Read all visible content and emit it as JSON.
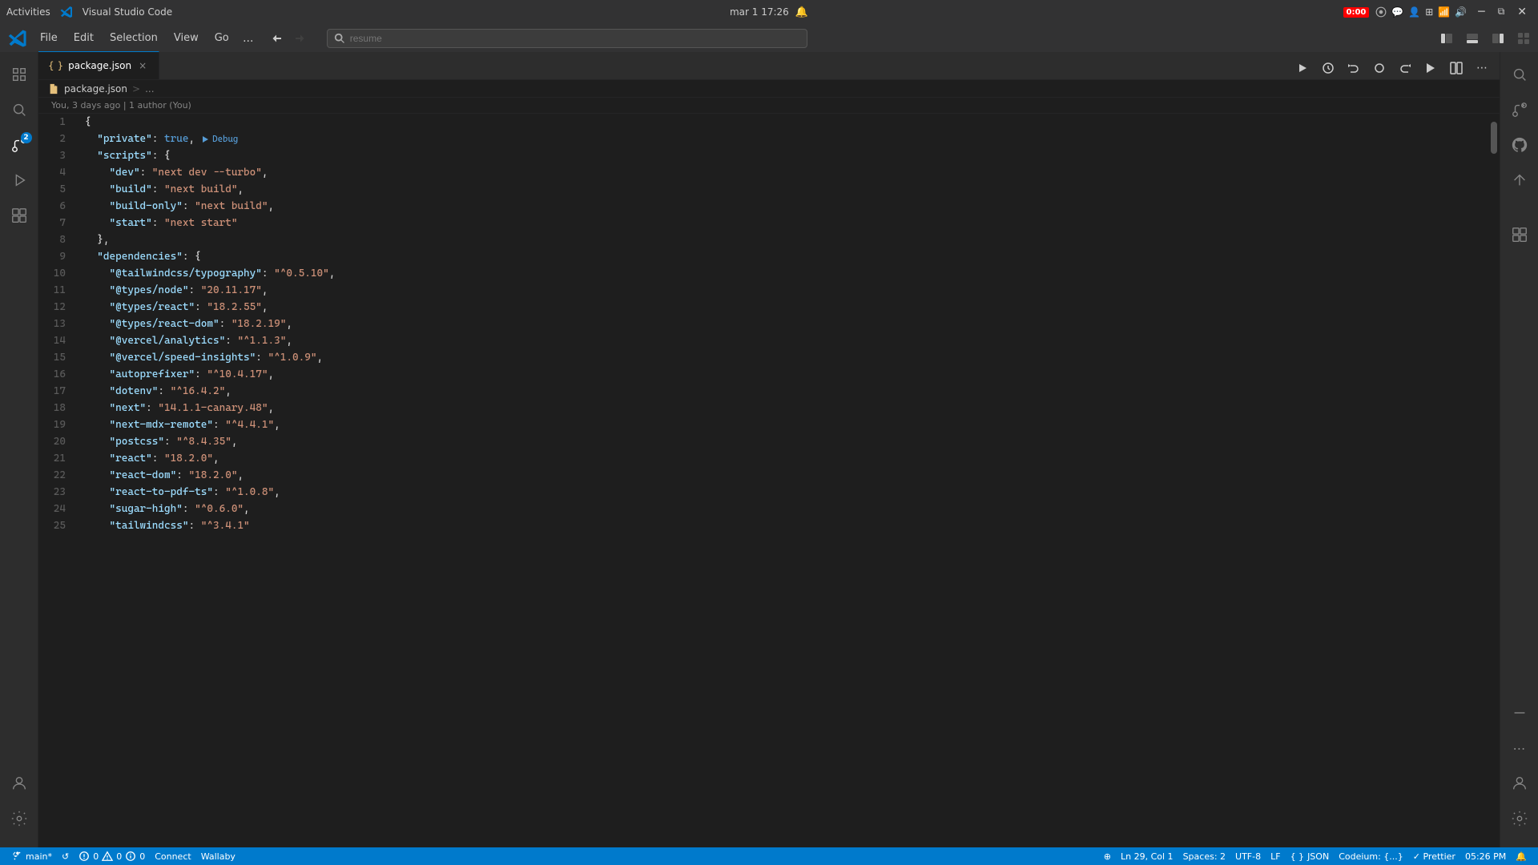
{
  "titlebar": {
    "activities_label": "Activities",
    "app_name": "Visual Studio Code",
    "date_time": "mar 1  17:26",
    "recording": "0:00",
    "search_placeholder": "resume"
  },
  "menu": {
    "items": [
      "File",
      "Edit",
      "Selection",
      "View",
      "Go"
    ],
    "more": "...",
    "nav_back": "←",
    "nav_fwd": "→"
  },
  "tab": {
    "filename": "package.json",
    "icon": "{ }",
    "close": "×"
  },
  "breadcrumb": {
    "file": "package.json",
    "sep": ">",
    "more": "..."
  },
  "git_blame": {
    "text": "You, 3 days ago | 1 author (You)"
  },
  "code": {
    "lines": [
      {
        "num": 1,
        "content": "{"
      },
      {
        "num": 2,
        "content": "  \"private\": true,"
      },
      {
        "num": 3,
        "content": "  \"scripts\": {"
      },
      {
        "num": 4,
        "content": "    \"dev\": \"next dev --turbo\","
      },
      {
        "num": 5,
        "content": "    \"build\": \"next build\","
      },
      {
        "num": 6,
        "content": "    \"build-only\": \"next build\","
      },
      {
        "num": 7,
        "content": "    \"start\": \"next start\""
      },
      {
        "num": 8,
        "content": "  },"
      },
      {
        "num": 9,
        "content": "  \"dependencies\": {"
      },
      {
        "num": 10,
        "content": "    \"@tailwindcss/typography\": \"^0.5.10\","
      },
      {
        "num": 11,
        "content": "    \"@types/node\": \"20.11.17\","
      },
      {
        "num": 12,
        "content": "    \"@types/react\": \"18.2.55\","
      },
      {
        "num": 13,
        "content": "    \"@types/react-dom\": \"18.2.19\","
      },
      {
        "num": 14,
        "content": "    \"@vercel/analytics\": \"^1.1.3\","
      },
      {
        "num": 15,
        "content": "    \"@vercel/speed-insights\": \"^1.0.9\","
      },
      {
        "num": 16,
        "content": "    \"autoprefixer\": \"^10.4.17\","
      },
      {
        "num": 17,
        "content": "    \"dotenv\": \"^16.4.2\","
      },
      {
        "num": 18,
        "content": "    \"next\": \"14.1.1-canary.48\","
      },
      {
        "num": 19,
        "content": "    \"next-mdx-remote\": \"^4.4.1\","
      },
      {
        "num": 20,
        "content": "    \"postcss\": \"^8.4.35\","
      },
      {
        "num": 21,
        "content": "    \"react\": \"18.2.0\","
      },
      {
        "num": 22,
        "content": "    \"react-dom\": \"18.2.0\","
      },
      {
        "num": 23,
        "content": "    \"react-to-pdf-ts\": \"^1.0.8\","
      },
      {
        "num": 24,
        "content": "    \"sugar-high\": \"^0.6.0\","
      },
      {
        "num": 25,
        "content": "    \"tailwindcss\": \"^3.4.1\""
      }
    ]
  },
  "statusbar": {
    "branch": "main*",
    "sync": "↺",
    "errors": "0",
    "warnings": "0",
    "info": "0",
    "connect": "Connect",
    "wallaby": "Wallaby",
    "zoom": "⊕",
    "cursor": "Ln 29, Col 1",
    "spaces": "Spaces: 2",
    "encoding": "UTF-8",
    "eol": "LF",
    "language": "JSON",
    "codeium": "Codeium: {...}",
    "prettier": "✓ Prettier",
    "time": "05:26 PM",
    "notification": "🔔"
  },
  "activity_icons": {
    "explorer": "📄",
    "search": "🔍",
    "source_control": "⎇",
    "run": "▶",
    "extensions": "⊞",
    "accounts": "👤",
    "settings": "⚙"
  },
  "right_panel_icons": {
    "run": "▶",
    "timeline": "⏱",
    "back": "←",
    "circle": "○",
    "forward": "→",
    "debug": "⏵",
    "split": "⧉",
    "more": "⋯"
  }
}
